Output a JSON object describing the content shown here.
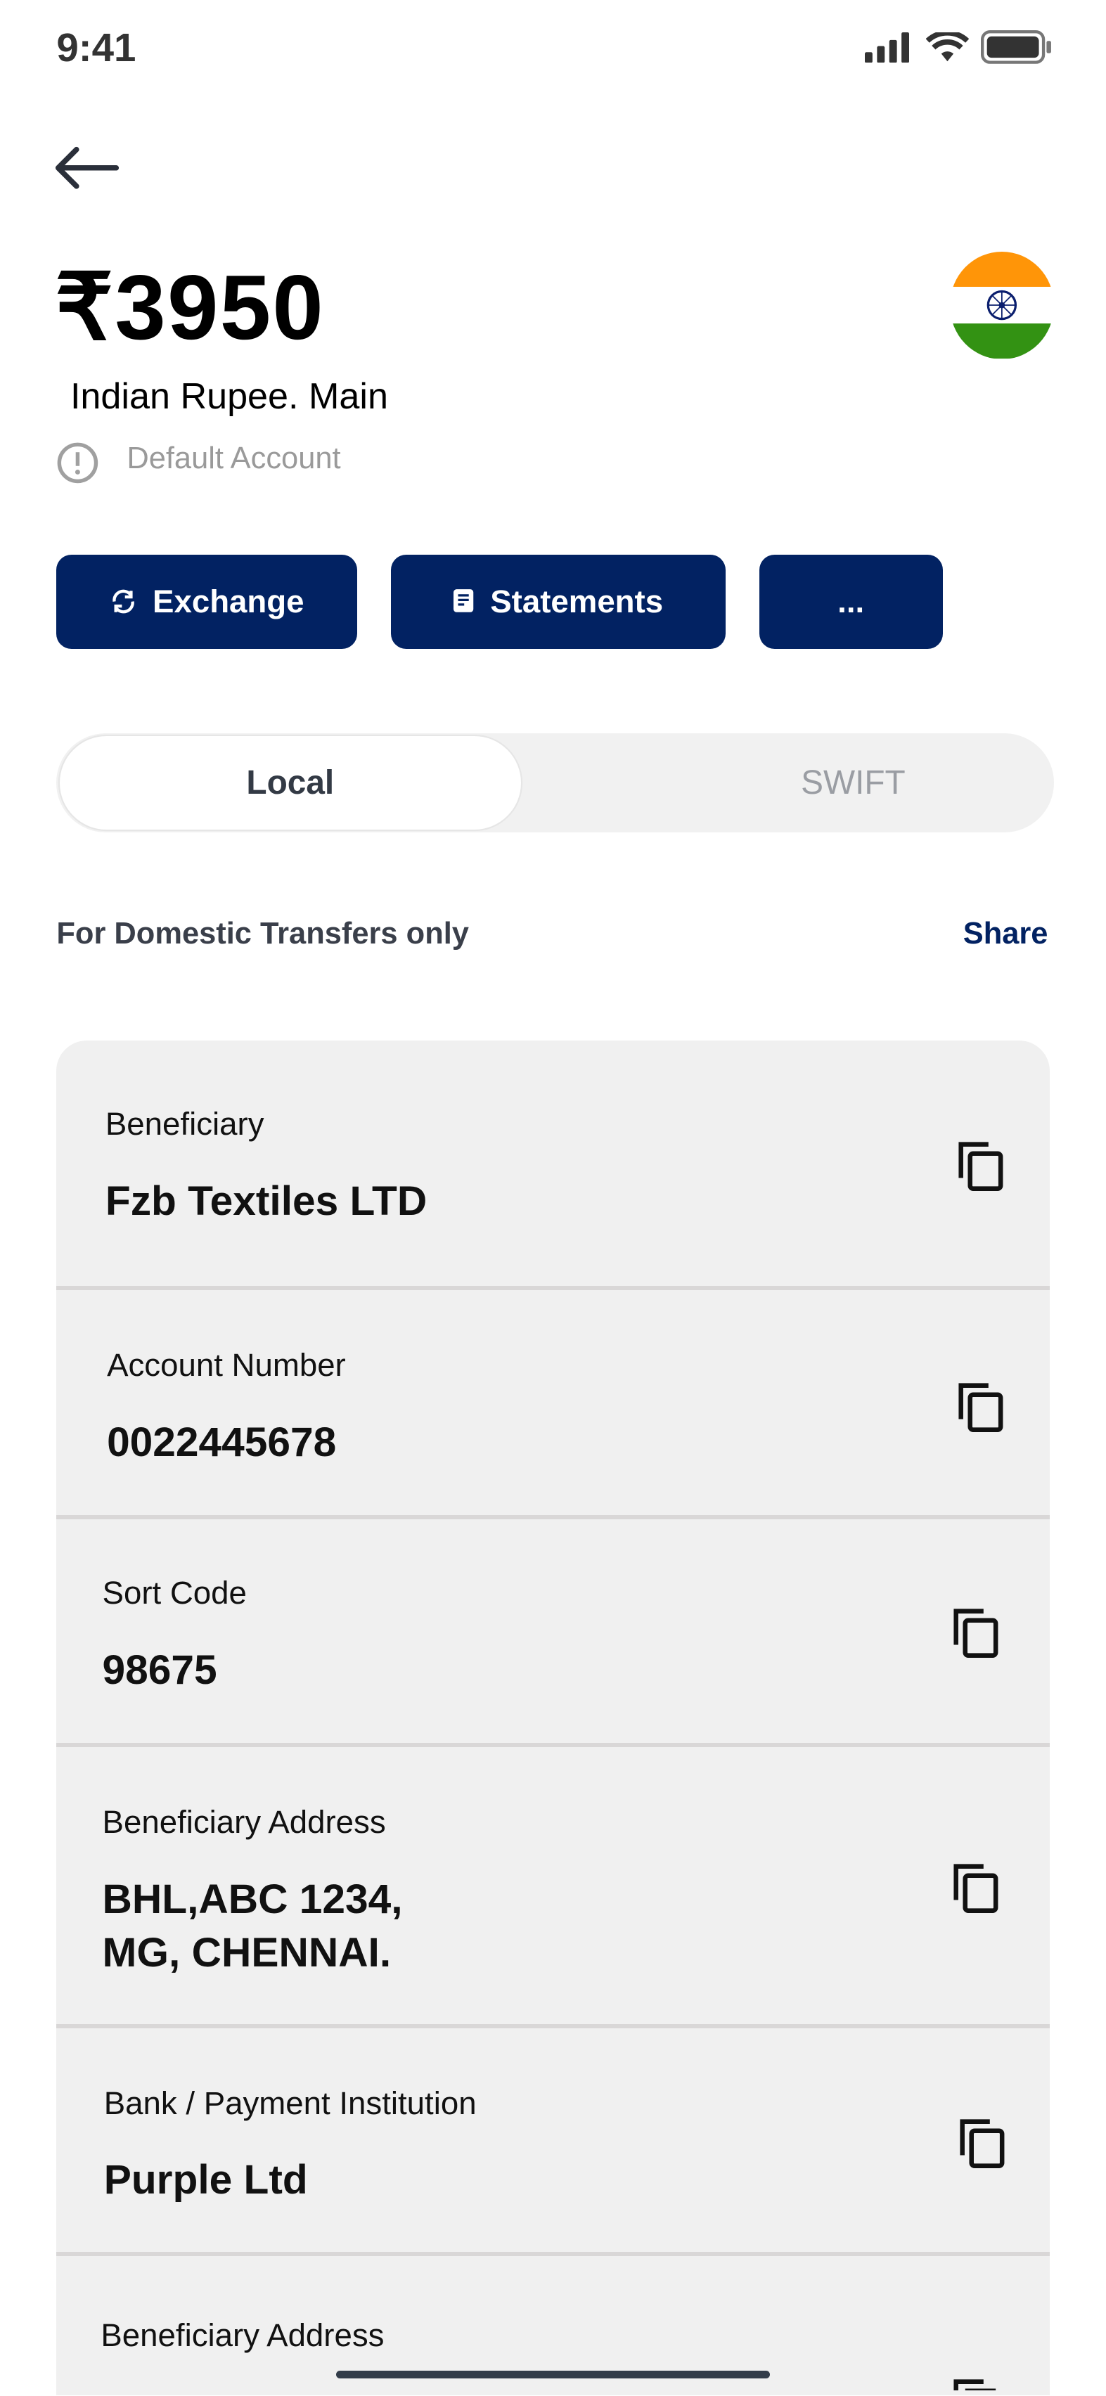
{
  "status_bar": {
    "time": "9:41"
  },
  "account": {
    "amount": "₹3950",
    "name": "Indian Rupee. Main",
    "default_label": "Default Account",
    "flag": "india-flag"
  },
  "actions": [
    {
      "label": "Exchange",
      "icon": "exchange-icon"
    },
    {
      "label": "Statements",
      "icon": "statements-icon"
    },
    {
      "label": "..."
    }
  ],
  "tabs": {
    "active": "Local",
    "other": "SWIFT"
  },
  "info_line": {
    "text": "For Domestic Transfers only",
    "share": "Share"
  },
  "details": [
    {
      "label": "Beneficiary",
      "value": "Fzb Textiles LTD"
    },
    {
      "label": "Account Number",
      "value": "0022445678"
    },
    {
      "label": "Sort Code",
      "value": "98675"
    },
    {
      "label": "Beneficiary Address",
      "value_line1": "BHL,ABC 1234,",
      "value_line2": "MG, CHENNAI."
    },
    {
      "label": "Bank / Payment Institution",
      "value": "Purple Ltd"
    },
    {
      "label": "Beneficiary Address"
    }
  ],
  "colors": {
    "primary": "#022262",
    "card": "#f0f0f0",
    "muted": "#9a9a9a"
  }
}
